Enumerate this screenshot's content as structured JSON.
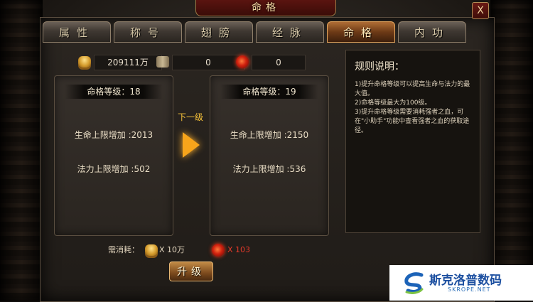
{
  "window": {
    "title": "命格",
    "close_glyph": "X"
  },
  "tabs": [
    {
      "label": "属性"
    },
    {
      "label": "称号"
    },
    {
      "label": "翅膀"
    },
    {
      "label": "经脉"
    },
    {
      "label": "命格",
      "active": true
    },
    {
      "label": "内功"
    }
  ],
  "currency": {
    "gold": "209111万",
    "bound_gold": "0",
    "blood": "0"
  },
  "current": {
    "level": "命格等级：18",
    "hp": "生命上限增加 :2013",
    "mp": "法力上限增加 :502"
  },
  "next_label": "下一级",
  "next": {
    "level": "命格等级：19",
    "hp": "生命上限增加 :2150",
    "mp": "法力上限增加 :536"
  },
  "rules": {
    "title": "规则说明：",
    "lines": [
      "1)提升命格等级可以提高生命与法力的最大值。",
      "2)命格等级最大为100级。",
      "3)提升命格等级需要消耗强者之血，可在\"小助手\"功能中查看强者之血的获取途径。"
    ]
  },
  "cost": {
    "label": "需消耗：",
    "gold": "X 10万",
    "blood": "X 103"
  },
  "upgrade_label": "升级",
  "watermark": {
    "title": "斯克洛普数码",
    "sub": "SKROPE.NET"
  },
  "colors": {
    "accent_gold": "#f7a51b",
    "blood_red": "#e63a2a",
    "tab_active": "#b06e35"
  }
}
